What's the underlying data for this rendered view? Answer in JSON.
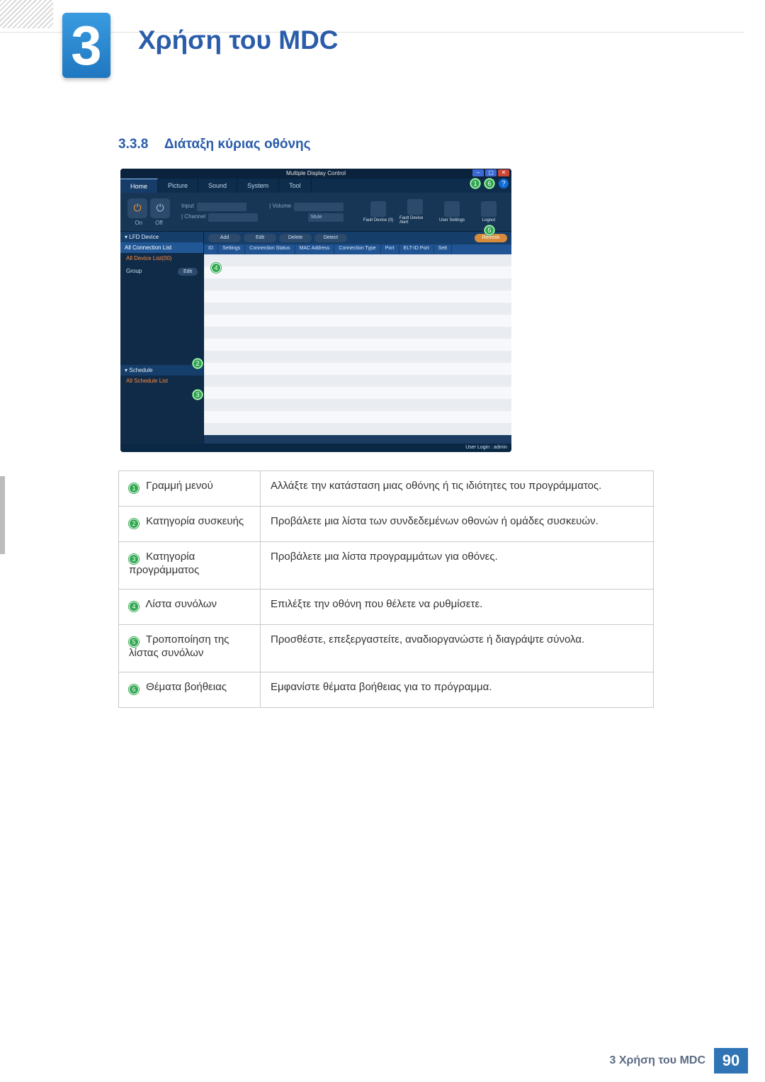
{
  "chapter": {
    "number": "3",
    "title": "Χρήση του MDC"
  },
  "section": {
    "number": "3.3.8",
    "title": "Διάταξη κύριας οθόνης"
  },
  "screenshot": {
    "window_title": "Multiple Display Control",
    "window_buttons": {
      "min": "–",
      "max": "▢",
      "close": "✕"
    },
    "help_icon": "?",
    "tabs": [
      "Home",
      "Picture",
      "Sound",
      "System",
      "Tool"
    ],
    "active_tab": "Home",
    "toolbar": {
      "on_label": "On",
      "off_label": "Off",
      "input_label": "Input",
      "channel_label": "| Channel",
      "volume_label": "| Volume",
      "mute_label": "Mute",
      "shortcuts": [
        {
          "label": "Fault Device (0)"
        },
        {
          "label": "Fault Device Alert"
        },
        {
          "label": "User Settings"
        },
        {
          "label": "Logout"
        }
      ]
    },
    "actions": {
      "add": "Add",
      "edit": "Edit",
      "delete": "Delete",
      "detect": "Detect",
      "refresh": "Refresh"
    },
    "list_columns": [
      "ID",
      "Settings",
      "Connection Status",
      "MAC Address",
      "Connection Type",
      "Port",
      "ELT-ID Port",
      "Sett"
    ],
    "sidebar": {
      "lfd_header": "▾  LFD Device",
      "all_connection": "All Connection List",
      "all_device": "All Device List(00)",
      "group": "Group",
      "edit": "Edit",
      "schedule_header": "▾  Schedule",
      "all_schedule": "All Schedule List"
    },
    "statusbar": "User Login : admin"
  },
  "callouts": {
    "c1": "1",
    "c2": "2",
    "c3": "3",
    "c4": "4",
    "c5": "5",
    "c6": "6"
  },
  "legend": [
    {
      "num": "1",
      "label": "Γραμμή μενού",
      "desc": "Αλλάξτε την κατάσταση μιας οθόνης ή τις ιδιότητες του προγράμματος."
    },
    {
      "num": "2",
      "label": "Κατηγορία συσκευής",
      "desc": "Προβάλετε μια λίστα των συνδεδεμένων οθονών ή ομάδες συσκευών."
    },
    {
      "num": "3",
      "label": "Κατηγορία προγράμματος",
      "desc": "Προβάλετε μια λίστα προγραμμάτων για οθόνες."
    },
    {
      "num": "4",
      "label": "Λίστα συνόλων",
      "desc": "Επιλέξτε την οθόνη που θέλετε να ρυθμίσετε."
    },
    {
      "num": "5",
      "label": "Τροποποίηση της λίστας συνόλων",
      "desc": "Προσθέστε, επεξεργαστείτε, αναδιοργανώστε ή διαγράψτε σύνολα."
    },
    {
      "num": "6",
      "label": "Θέματα βοήθειας",
      "desc": "Εμφανίστε θέματα βοήθειας για το πρόγραμμα."
    }
  ],
  "footer": {
    "text": "3 Χρήση του MDC",
    "page": "90"
  }
}
